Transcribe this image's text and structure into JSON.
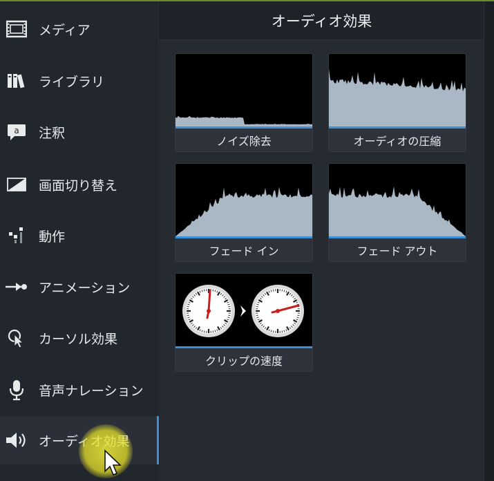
{
  "sidebar": {
    "items": [
      {
        "label": "メディア",
        "icon": "film-strip-icon"
      },
      {
        "label": "ライブラリ",
        "icon": "library-books-icon"
      },
      {
        "label": "注釈",
        "icon": "callout-icon"
      },
      {
        "label": "画面切り替え",
        "icon": "transition-icon"
      },
      {
        "label": "動作",
        "icon": "behavior-icon"
      },
      {
        "label": "アニメーション",
        "icon": "animation-arrow-icon"
      },
      {
        "label": "カーソル効果",
        "icon": "cursor-effect-icon"
      },
      {
        "label": "音声ナレーション",
        "icon": "microphone-icon"
      },
      {
        "label": "オーディオ効果",
        "icon": "speaker-icon",
        "active": true
      }
    ]
  },
  "panel": {
    "title": "オーディオ効果",
    "effects": [
      {
        "label": "ノイズ除去",
        "icon": "noise-removal-waveform-icon"
      },
      {
        "label": "オーディオの圧縮",
        "icon": "audio-compression-waveform-icon"
      },
      {
        "label": "フェード イン",
        "icon": "fade-in-waveform-icon"
      },
      {
        "label": "フェード アウト",
        "icon": "fade-out-waveform-icon"
      },
      {
        "label": "クリップの速度",
        "icon": "clip-speed-clocks-icon"
      }
    ]
  },
  "colors": {
    "accent": "#3b8fd6",
    "sidebar_bg": "#22262d",
    "panel_bg": "#262b32",
    "waveform": "#a9b8c4",
    "highlight": "#eeea3c"
  }
}
